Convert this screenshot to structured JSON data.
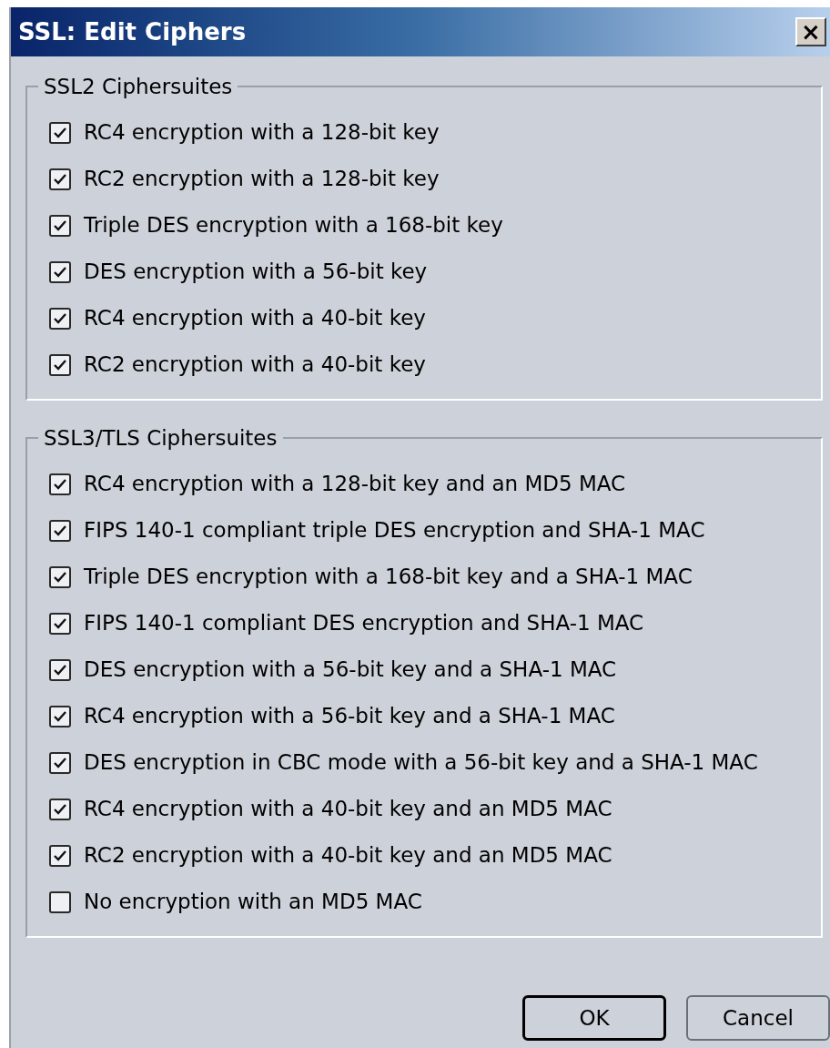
{
  "window": {
    "title": "SSL: Edit Ciphers",
    "close": "×"
  },
  "groups": [
    {
      "title": "SSL2 Ciphersuites",
      "items": [
        {
          "label": "RC4 encryption with a 128-bit key",
          "checked": true
        },
        {
          "label": "RC2 encryption with a 128-bit key",
          "checked": true
        },
        {
          "label": "Triple DES encryption with a 168-bit key",
          "checked": true
        },
        {
          "label": "DES encryption with a 56-bit key",
          "checked": true
        },
        {
          "label": "RC4 encryption with a 40-bit key",
          "checked": true
        },
        {
          "label": "RC2 encryption with a 40-bit key",
          "checked": true
        }
      ]
    },
    {
      "title": "SSL3/TLS Ciphersuites",
      "items": [
        {
          "label": "RC4 encryption with a 128-bit key and an MD5 MAC",
          "checked": true
        },
        {
          "label": "FIPS 140-1 compliant triple DES encryption and SHA-1 MAC",
          "checked": true
        },
        {
          "label": "Triple DES encryption with a 168-bit key and a SHA-1 MAC",
          "checked": true
        },
        {
          "label": "FIPS 140-1 compliant DES encryption and SHA-1 MAC",
          "checked": true
        },
        {
          "label": "DES encryption with a 56-bit key and a SHA-1 MAC",
          "checked": true
        },
        {
          "label": "RC4 encryption with a 56-bit key and a SHA-1 MAC",
          "checked": true
        },
        {
          "label": "DES encryption in CBC mode with a 56-bit key and a SHA-1 MAC",
          "checked": true
        },
        {
          "label": "RC4 encryption with a 40-bit key and an MD5 MAC",
          "checked": true
        },
        {
          "label": "RC2 encryption with a 40-bit key and an MD5 MAC",
          "checked": true
        },
        {
          "label": "No encryption with an MD5 MAC",
          "checked": false
        }
      ]
    }
  ],
  "buttons": [
    {
      "label": "OK",
      "default": true
    },
    {
      "label": "Cancel",
      "default": false
    }
  ]
}
